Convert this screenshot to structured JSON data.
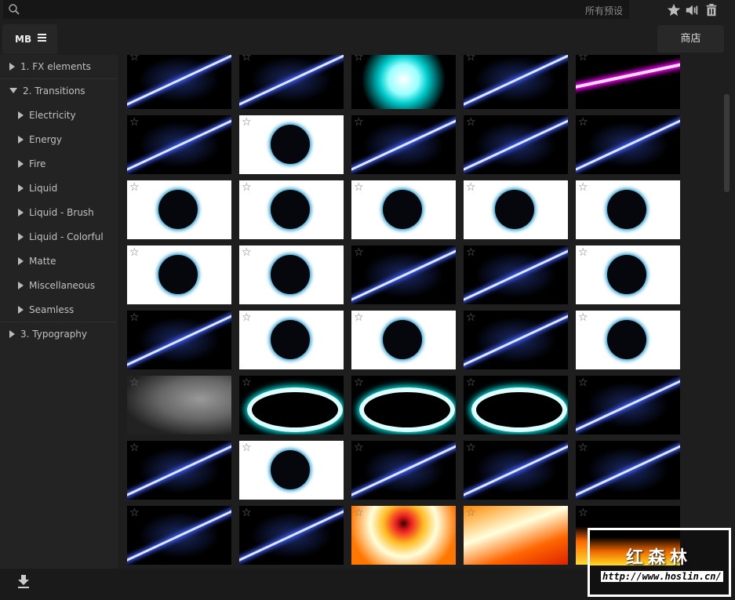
{
  "search": {
    "placeholder": "",
    "scope": "所有预设"
  },
  "toolbar": {
    "favorites": "star-icon",
    "audio": "speaker-icon",
    "delete": "trash-icon"
  },
  "tabs": {
    "main": "MB",
    "shop": "商店"
  },
  "sidebar": {
    "items": [
      {
        "label": "1. FX elements",
        "level": 0,
        "expanded": false
      },
      {
        "label": "2. Transitions",
        "level": 0,
        "expanded": true
      },
      {
        "label": "Electricity",
        "level": 1
      },
      {
        "label": "Energy",
        "level": 1
      },
      {
        "label": "Fire",
        "level": 1
      },
      {
        "label": "Liquid",
        "level": 1
      },
      {
        "label": "Liquid - Brush",
        "level": 1
      },
      {
        "label": "Liquid - Colorful",
        "level": 1
      },
      {
        "label": "Matte",
        "level": 1
      },
      {
        "label": "Miscellaneous",
        "level": 1
      },
      {
        "label": "Seamless",
        "level": 1
      },
      {
        "label": "3. Typography",
        "level": 0,
        "expanded": false
      }
    ]
  },
  "grid": {
    "thumbnails": [
      "dark",
      "dark",
      "cyan",
      "dark",
      "magenta",
      "dark",
      "white",
      "dark",
      "dark",
      "dark",
      "white",
      "white",
      "white",
      "white",
      "white",
      "white",
      "white",
      "dark",
      "dark",
      "white",
      "dark",
      "white",
      "white",
      "dark",
      "white",
      "smoke",
      "cyanb",
      "cyanb",
      "cyanb",
      "dark",
      "dark",
      "white",
      "dark",
      "dark",
      "dark",
      "dark",
      "dark",
      "fire",
      "fire2",
      "fire3"
    ]
  },
  "watermark": {
    "title": "红森林",
    "url": "http://www.hoslin.cn/"
  }
}
